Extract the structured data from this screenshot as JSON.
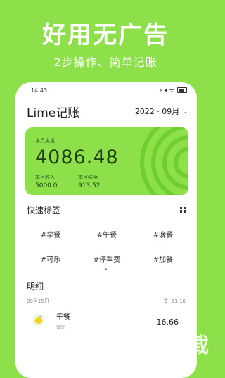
{
  "promo": {
    "headline": "好用无广告",
    "subline": "2步操作、简单记账"
  },
  "status_bar": {
    "time": "14:43",
    "icons": "⚡ ▾ ᯤ"
  },
  "header": {
    "app_title": "Lime记账",
    "date": "2022 · 09月",
    "chevron": "⌄"
  },
  "summary": {
    "expense_label": "本月支出",
    "expense_value": "4086.48",
    "income_label": "本月收入",
    "income_value": "5000.0",
    "balance_label": "本月结余",
    "balance_value": "913.52"
  },
  "quick_tags": {
    "title": "快速标签",
    "items": [
      "#早餐",
      "#午餐",
      "#晚餐",
      "#可乐",
      "#停车费",
      "#加餐"
    ],
    "pager": "•"
  },
  "details": {
    "title": "明细",
    "day": "09月15日",
    "day_total": "支: 63.16",
    "entries": [
      {
        "name": "午餐",
        "sub": "餐饮",
        "amount": "16.66",
        "icon": "lemon-icon"
      }
    ]
  },
  "watermark": {
    "text": "KK下载"
  },
  "colors": {
    "brand_green": "#8ee04a",
    "ring_green": "#6fcf2e"
  }
}
